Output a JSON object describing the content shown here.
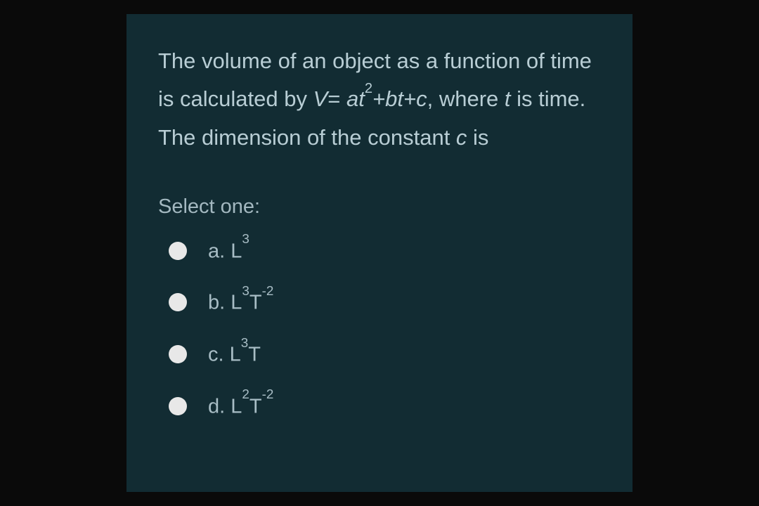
{
  "question": {
    "part1": "The volume of an object as a function of time is calculated by ",
    "part2": "V",
    "part3": "= ",
    "part4": "at",
    "sup1": "2",
    "part5": "+bt+c",
    "part6": ", where ",
    "part7": "t",
    "part8": " is time. The dimension of the constant ",
    "part9": "c",
    "part10": "  is"
  },
  "select_label": "Select one:",
  "options": {
    "a": {
      "letter": "a. ",
      "base1": "L",
      "sup1": "3"
    },
    "b": {
      "letter": "b. ",
      "base1": "L",
      "sup1": "3",
      "base2": "T",
      "sup2": "-2"
    },
    "c": {
      "letter": "c. ",
      "base1": "L",
      "sup1": "3",
      "base2": "T"
    },
    "d": {
      "letter": "d. ",
      "base1": "L",
      "sup1": "2",
      "base2": "T",
      "sup2": "-2"
    }
  }
}
